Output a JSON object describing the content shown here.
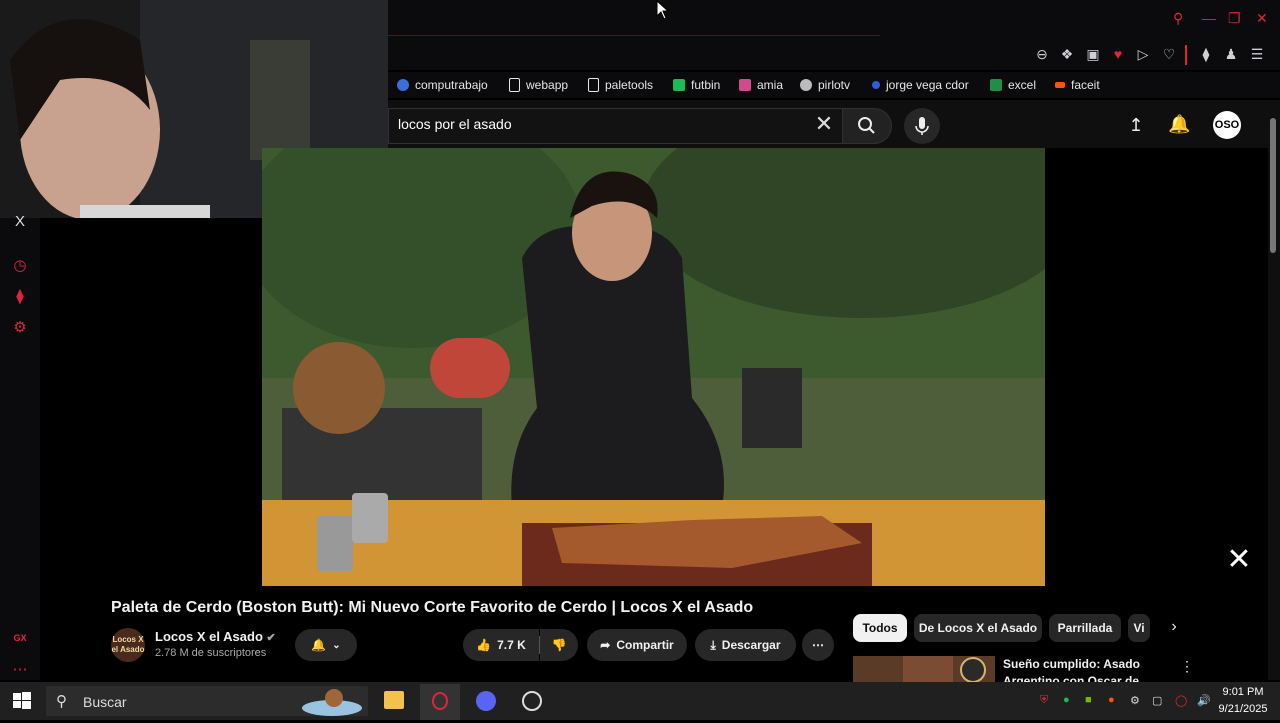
{
  "browser": {
    "bookmarks": [
      {
        "label": "computrabajo",
        "color": "#3b6fd8"
      },
      {
        "label": "webapp",
        "color": "#e6e6e6"
      },
      {
        "label": "paletools",
        "color": "#e6e6e6"
      },
      {
        "label": "futbin",
        "color": "#1db954"
      },
      {
        "label": "amia",
        "color": "#d14a8a"
      },
      {
        "label": "pirlotv",
        "color": "#bbbbbb"
      },
      {
        "label": "jorge vega cdor",
        "color": "#2d5be3"
      },
      {
        "label": "excel",
        "color": "#1d8f46"
      },
      {
        "label": "faceit",
        "color": "#ff5500"
      }
    ],
    "accent": "#e0243d"
  },
  "youtube": {
    "search_query": "locos por el asado",
    "avatar_text": "OSO",
    "video_title": "Paleta de Cerdo (Boston Butt): Mi Nuevo Corte Favorito de Cerdo | Locos X el Asado",
    "channel": {
      "name": "Locos X el Asado",
      "subscribers": "2.78 M de suscriptores",
      "avatar_text": "Locos X el Asado"
    },
    "actions": {
      "likes": "7.7 K",
      "share": "Compartir",
      "download": "Descargar"
    },
    "chips": [
      "Todos",
      "De Locos X el Asado",
      "Parrillada",
      "Vi"
    ],
    "recommended": {
      "title_line1": "Sueño cumplido: Asado",
      "title_line2": "Argentino con Oscar de"
    }
  },
  "sidebar": {
    "gx_label": "GX",
    "x_label": "X"
  },
  "taskbar": {
    "search_placeholder": "Buscar",
    "time": "9:01 PM",
    "date": "9/21/2025"
  }
}
